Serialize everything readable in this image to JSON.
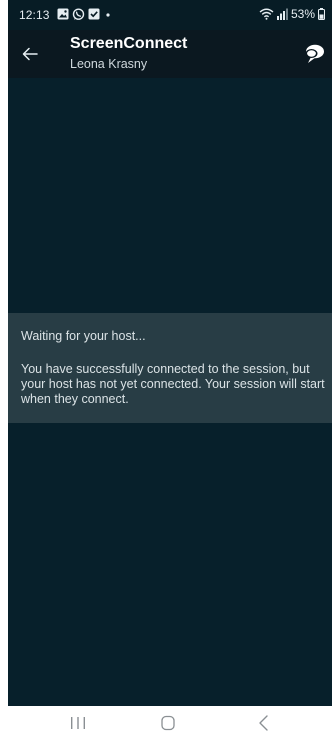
{
  "status_bar": {
    "time": "12:13",
    "battery": "53%",
    "left_icons": [
      "gallery-icon",
      "whatsapp-icon",
      "checkbox-icon",
      "dot-icon"
    ],
    "right_icons": [
      "wifi-icon",
      "signal-icon",
      "battery-icon"
    ]
  },
  "app_bar": {
    "title": "ScreenConnect",
    "subtitle": "Leona Krasny",
    "back_icon": "arrow-left-icon",
    "chat_icon": "chat-bubbles-icon"
  },
  "waiting": {
    "title": "Waiting for your host...",
    "message": "You have successfully connected to the session, but your host has not yet connected. Your session will start when they connect."
  },
  "nav_bar": {
    "icons": [
      "recents-icon",
      "home-icon",
      "back-icon"
    ]
  },
  "colors": {
    "background": "#07202b",
    "app_bar": "#0b1820",
    "panel": "#283d45",
    "text": "#dbe3e6"
  }
}
